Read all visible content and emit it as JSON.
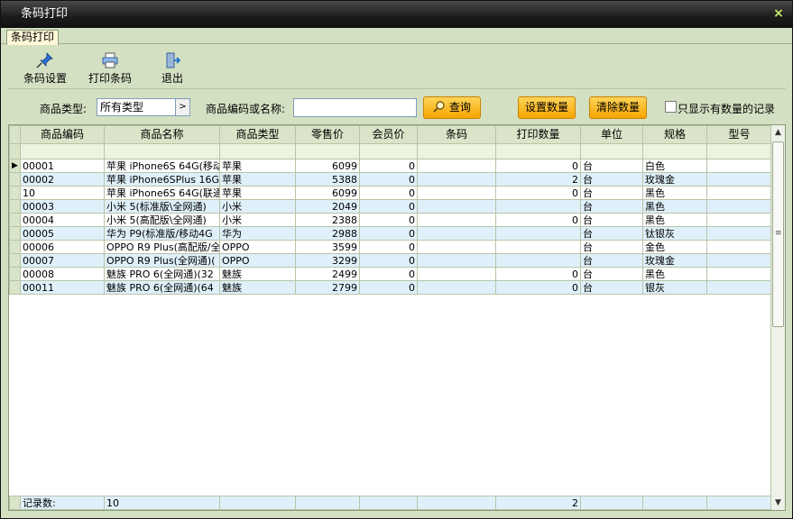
{
  "window": {
    "title": "条码打印",
    "close": "×"
  },
  "tabs": [
    "条码打印"
  ],
  "toolbar": {
    "barcode_settings": "条码设置",
    "print_barcode": "打印条码",
    "exit": "退出"
  },
  "filter": {
    "type_label": "商品类型:",
    "type_value": "所有类型",
    "code_label": "商品编码或名称:",
    "code_value": "",
    "search": "查询",
    "set_qty": "设置数量",
    "clear_qty": "清除数量",
    "only_qty_label": "只显示有数量的记录"
  },
  "grid": {
    "columns": [
      "商品编码",
      "商品名称",
      "商品类型",
      "零售价",
      "会员价",
      "条码",
      "打印数量",
      "单位",
      "规格",
      "型号"
    ],
    "rows": [
      [
        "00001",
        "苹果 iPhone6S 64G(移动",
        "苹果",
        "6099",
        "0",
        "",
        "0",
        "台",
        "白色",
        ""
      ],
      [
        "00002",
        "苹果 iPhone6SPlus 16G",
        "苹果",
        "5388",
        "0",
        "",
        "2",
        "台",
        "玫瑰金",
        ""
      ],
      [
        "10",
        "苹果 iPhone6S 64G(联通",
        "苹果",
        "6099",
        "0",
        "",
        "0",
        "台",
        "黑色",
        ""
      ],
      [
        "00003",
        "小米 5(标准版\\全网通)",
        "小米",
        "2049",
        "0",
        "",
        "",
        "台",
        "黑色",
        ""
      ],
      [
        "00004",
        "小米 5(高配版\\全网通)",
        "小米",
        "2388",
        "0",
        "",
        "0",
        "台",
        "黑色",
        ""
      ],
      [
        "00005",
        "华为 P9(标准版/移动4G",
        "华为",
        "2988",
        "0",
        "",
        "",
        "台",
        "钛银灰",
        ""
      ],
      [
        "00006",
        "OPPO R9 Plus(高配版/全",
        "OPPO",
        "3599",
        "0",
        "",
        "",
        "台",
        "金色",
        ""
      ],
      [
        "00007",
        "OPPO R9 Plus(全网通)(",
        "OPPO",
        "3299",
        "0",
        "",
        "",
        "台",
        "玫瑰金",
        ""
      ],
      [
        "00008",
        "魅族 PRO 6(全网通)(32",
        "魅族",
        "2499",
        "0",
        "",
        "0",
        "台",
        "黑色",
        ""
      ],
      [
        "00011",
        "魅族 PRO 6(全网通)(64",
        "魅族",
        "2799",
        "0",
        "",
        "0",
        "台",
        "银灰",
        ""
      ]
    ],
    "footer": {
      "label": "记录数:",
      "count": "10",
      "print_qty_total": "2"
    }
  },
  "colors": {
    "accent": "#f7a500",
    "panel": "#d4e0c2",
    "row_alt": "#dff0fa"
  },
  "icons": {
    "barcode_settings": "pin-icon",
    "print_barcode": "printer-icon",
    "exit": "exit-door-icon",
    "search": "magnifier-icon",
    "row_pointer": "row-pointer-icon"
  }
}
